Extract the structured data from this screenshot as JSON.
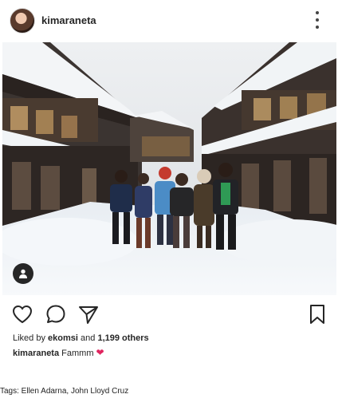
{
  "post": {
    "username": "kimaraneta",
    "more_icon": "more-vertical-icon",
    "avatar_icon": "profile-avatar"
  },
  "photo": {
    "description_icon": "group-photo-snowy-street",
    "user_tag_icon": "person-icon"
  },
  "actions": {
    "like_icon": "heart-outline-icon",
    "comment_icon": "speech-bubble-icon",
    "share_icon": "paper-plane-icon",
    "save_icon": "bookmark-icon"
  },
  "likes": {
    "prefix": "Liked by",
    "first_user": "ekomsi",
    "connector": "and",
    "others": "1,199 others"
  },
  "caption": {
    "username": "kimaraneta",
    "text": "Fammm",
    "emoji": "❤"
  },
  "tags_line": "Tags: Ellen Adarna, John Lloyd Cruz",
  "colors": {
    "text": "#262626",
    "heart_emoji": "#e0245e",
    "background": "#ffffff"
  }
}
